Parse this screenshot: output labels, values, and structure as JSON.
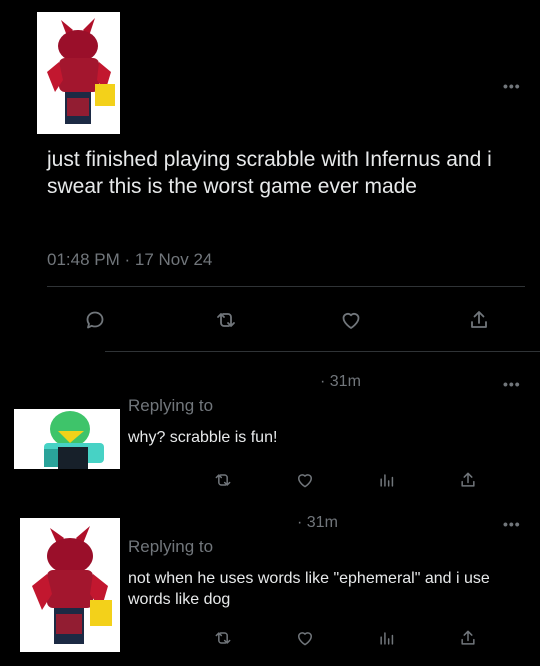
{
  "post": {
    "text": "just finished playing scrabble with Infernus and i swear this is the worst game ever made",
    "timestamp": "01:48 PM · 17 Nov 24",
    "more_label": "•••",
    "actions": [
      "reply-icon",
      "retweet-icon",
      "like-icon",
      "share-icon"
    ]
  },
  "replies": [
    {
      "time": "· 31m",
      "replying_to": "Replying to",
      "text": "why? scrabble is fun!",
      "more_label": "•••",
      "actions": [
        "retweet-icon",
        "like-icon",
        "analytics-icon",
        "share-icon"
      ]
    },
    {
      "time": "· 31m",
      "replying_to": "Replying to",
      "text": "not when he uses words like \"ephemeral\" and i use words like dog",
      "more_label": "•••",
      "actions": [
        "retweet-icon",
        "like-icon",
        "analytics-icon",
        "share-icon"
      ]
    }
  ],
  "colors": {
    "background": "#000000",
    "text": "#e7e9ea",
    "muted": "#71767b",
    "divider": "#2f3336"
  }
}
